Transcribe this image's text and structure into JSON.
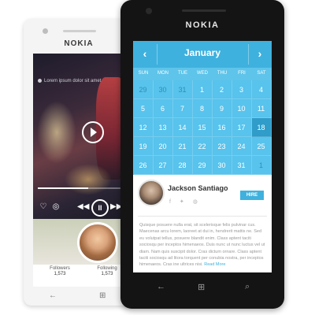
{
  "back_phone": {
    "brand": "NOKIA",
    "music": {
      "caption": "Lorem ipsum dolor sit amet",
      "progress": 0.58
    },
    "followers": {
      "label": "Followers",
      "value": "1,573"
    },
    "following": {
      "label": "Following",
      "value": "1,573"
    }
  },
  "front_phone": {
    "brand": "NOKIA",
    "calendar": {
      "month": "January",
      "prev_glyph": "‹",
      "next_glyph": "›",
      "weekdays": [
        "SUN",
        "MON",
        "TUE",
        "WED",
        "THU",
        "FRI",
        "SAT"
      ],
      "rows": [
        [
          "29",
          "30",
          "31",
          "1",
          "2",
          "3",
          "4"
        ],
        [
          "5",
          "6",
          "7",
          "8",
          "9",
          "10",
          "11"
        ],
        [
          "12",
          "13",
          "14",
          "15",
          "16",
          "17",
          "18"
        ],
        [
          "19",
          "20",
          "21",
          "22",
          "23",
          "24",
          "25"
        ],
        [
          "26",
          "27",
          "28",
          "29",
          "30",
          "31",
          "1"
        ]
      ],
      "selected": "18",
      "accent": "#3fb1de"
    },
    "profile": {
      "name": "Jackson Santiago",
      "hire_label": "HIRE",
      "bio": "Quisque posuere nulla erat, sit scelerisque felis pulvinar cus. Maecenas arcu lorem, laoreet at dui in, hendrerit mattis ne. Sed eu volutpat tellus, posuere blandit enim. Class aptent taciti sociosqu per inceptos himenaeos. Duis nunc ut nunc luctus vel ut diam. Nam quis suscipit dolor. Cras dictum ornare. Class aptent taciti sociosqu ad litora torquent per conubia nostra, per inceptos himenaeos. Cras ine ultrices nisi.",
      "read_more": "Read More"
    },
    "nav": {
      "back": "←",
      "start": "⊞",
      "search": "⌕"
    }
  }
}
